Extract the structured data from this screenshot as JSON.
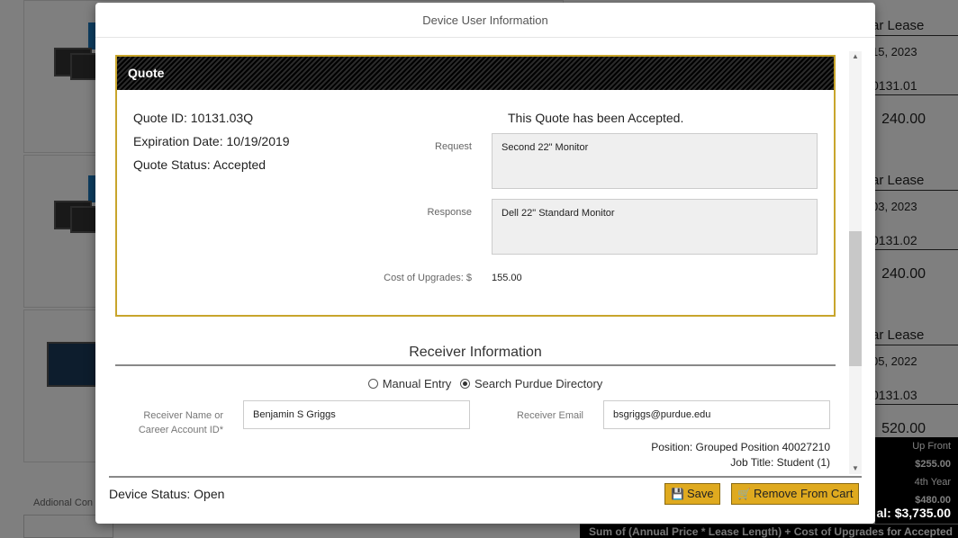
{
  "modal": {
    "title": "Device User Information",
    "quote": {
      "header": "Quote",
      "id_line": "Quote ID: 10131.03Q",
      "expiration_line": "Expiration Date: 10/19/2019",
      "status_line": "Quote Status: Accepted",
      "accepted_text": "This Quote has been Accepted.",
      "request_label": "Request",
      "request_value": "Second 22\" Monitor",
      "response_label": "Response",
      "response_value": "Dell 22\" Standard Monitor",
      "cost_label": "Cost of Upgrades: $",
      "cost_value": "155.00"
    },
    "receiver": {
      "title": "Receiver Information",
      "option_manual": "Manual Entry",
      "option_search": "Search Purdue Directory",
      "selected_option": "Search Purdue Directory",
      "name_label": "Receiver Name or Career Account ID*",
      "name_value": "Benjamin S Griggs",
      "email_label": "Receiver Email",
      "email_value": "bsgriggs@purdue.edu",
      "position_line": "Position: Grouped Position 40027210",
      "job_title_line": "Job Title: Student (1)"
    },
    "footer": {
      "device_status": "Device Status: Open",
      "save_label": "Save",
      "remove_label": "Remove From Cart"
    }
  },
  "background": {
    "items": [
      {
        "lease": "ar Lease",
        "date": "15, 2023",
        "quote_id": "0131.01",
        "price": "240.00"
      },
      {
        "lease": "ar Lease",
        "date": "03, 2023",
        "quote_id": "0131.02",
        "price": "240.00"
      },
      {
        "lease": "ar Lease",
        "date": "05, 2022",
        "quote_id": "0131.03",
        "price": "520.00"
      }
    ],
    "additional_label": "Addional Con",
    "summary": {
      "up_front_label": "Up Front",
      "up_front_value": "$255.00",
      "fourth_year_label": "4th Year",
      "fourth_year_value": "$480.00",
      "total": "al: $3,735.00",
      "note": "Sum of (Annual Price * Lease Length) + Cost of Upgrades for Accepted Quotes"
    }
  },
  "colors": {
    "accent_gold": "#dfaa1f",
    "quote_border": "#c8a52c"
  },
  "icons": {
    "save": "save-icon",
    "cart": "cart-remove-icon"
  }
}
